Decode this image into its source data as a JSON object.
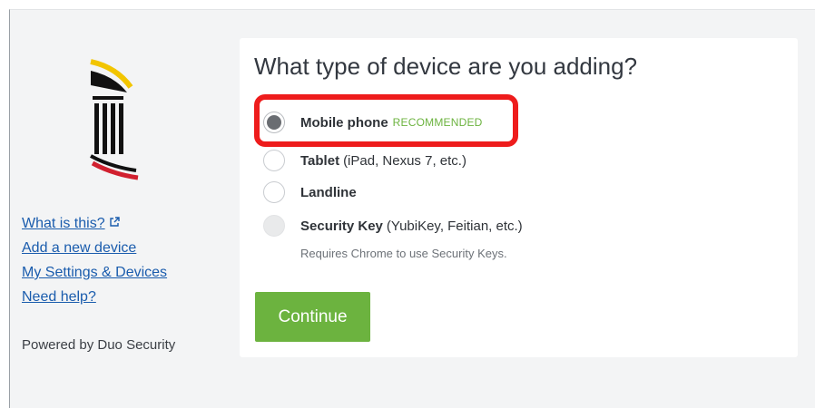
{
  "sidebar": {
    "links": [
      {
        "label": "What is this?",
        "icon": "external-link-icon"
      },
      {
        "label": "Add a new device"
      },
      {
        "label": "My Settings & Devices"
      },
      {
        "label": "Need help?"
      }
    ],
    "powered_by": "Powered by Duo Security",
    "logo_icon": "university-logo-icon"
  },
  "main": {
    "title": "What type of device are you adding?",
    "options": [
      {
        "label": "Mobile phone",
        "badge": "RECOMMENDED",
        "detail": "",
        "selected": true,
        "disabled": false
      },
      {
        "label": "Tablet",
        "detail": "(iPad, Nexus 7, etc.)",
        "selected": false,
        "disabled": false
      },
      {
        "label": "Landline",
        "detail": "",
        "selected": false,
        "disabled": false
      },
      {
        "label": "Security Key",
        "detail": "(YubiKey, Feitian, etc.)",
        "selected": false,
        "disabled": true
      }
    ],
    "security_key_note": "Requires Chrome to use Security Keys.",
    "continue_label": "Continue"
  },
  "colors": {
    "accent_green": "#6cb33f",
    "link_blue": "#1a5cad",
    "highlight_red": "#ee1c1c",
    "background": "#f3f4f5"
  }
}
